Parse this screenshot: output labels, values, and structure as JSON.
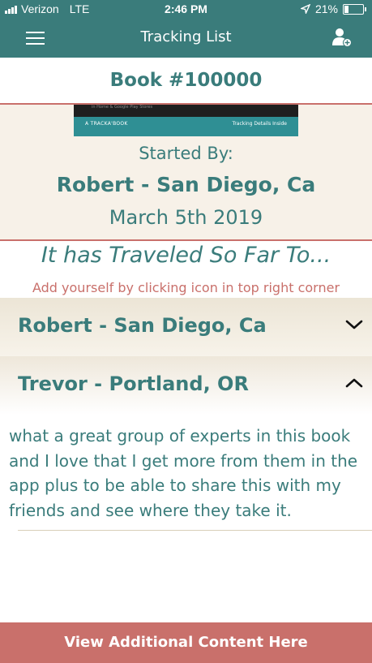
{
  "status_bar": {
    "carrier": "Verizon",
    "network": "LTE",
    "time": "2:46 PM",
    "battery": "21%",
    "battery_level": 0.21
  },
  "nav": {
    "title": "Tracking List",
    "menu_icon": "hamburger-menu-icon",
    "add_icon": "add-user-icon"
  },
  "book": {
    "title": "Book #100000"
  },
  "cover": {
    "brand": "A TRACKA'BOOK",
    "tagline": "Tracking Details Inside",
    "top_text": "in Home & Google Play Stores"
  },
  "started": {
    "label": "Started By:",
    "name": "Robert - San Diego, Ca",
    "date": "March 5th 2019"
  },
  "traveled": {
    "heading": "It has Traveled So Far To...",
    "hint": "Add yourself by clicking icon in top right corner"
  },
  "locations": [
    {
      "name": "Robert - San Diego, Ca",
      "expanded": false
    },
    {
      "name": "Trevor - Portland, OR",
      "expanded": true,
      "comment": "what a great group of experts in this book and I love that I get more from them in the app plus to be able to share this with my friends and see where they take it."
    }
  ],
  "footer": {
    "label": "View Additional Content Here"
  },
  "colors": {
    "teal": "#3a7c7b",
    "coral": "#c9706b",
    "cream": "#f7f1e8"
  }
}
